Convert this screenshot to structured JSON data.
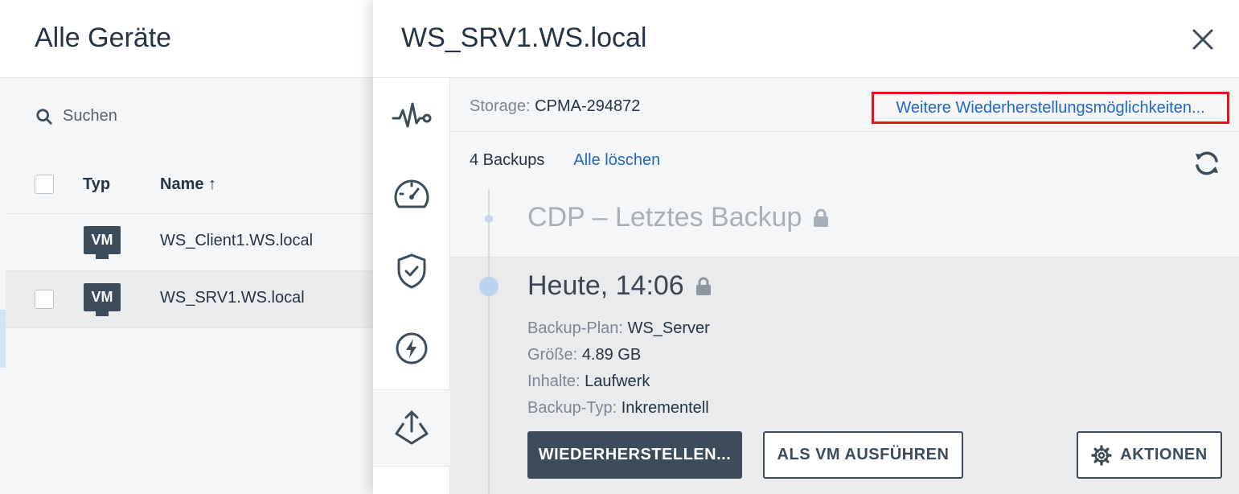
{
  "left": {
    "title": "Alle Geräte",
    "search_label": "Suchen",
    "columns": {
      "type": "Typ",
      "name": "Name ↑"
    },
    "rows": [
      {
        "type": "VM",
        "name": "WS_Client1.WS.local",
        "selected": false,
        "checkbox_visible": false
      },
      {
        "type": "VM",
        "name": "WS_SRV1.WS.local",
        "selected": true,
        "checkbox_visible": true
      }
    ]
  },
  "drawer": {
    "title": "WS_SRV1.WS.local",
    "icon_bar": [
      "activity-icon",
      "gauge-icon",
      "shield-check-icon",
      "lightning-icon",
      "recovery-icon"
    ],
    "storage_label": "Storage:",
    "storage_value": "CPMA-294872",
    "more_recovery_link": "Weitere Wiederherstellungsmöglichkeiten...",
    "backups_count": "4 Backups",
    "delete_all": "Alle löschen",
    "cdp_title": "CDP – Letztes Backup",
    "backup": {
      "title": "Heute, 14:06",
      "plan_label": "Backup-Plan:",
      "plan_value": "WS_Server",
      "size_label": "Größe:",
      "size_value": "4.89 GB",
      "contents_label": "Inhalte:",
      "contents_value": "Laufwerk",
      "type_label": "Backup-Typ:",
      "type_value": "Inkrementell"
    },
    "buttons": {
      "restore": "WIEDERHERSTELLEN...",
      "run_as_vm": "ALS VM AUSFÜHREN",
      "actions": "AKTIONEN"
    }
  },
  "colors": {
    "dark": "#3c4c5b",
    "link": "#1f68c4",
    "highlight": "#e8131f"
  }
}
